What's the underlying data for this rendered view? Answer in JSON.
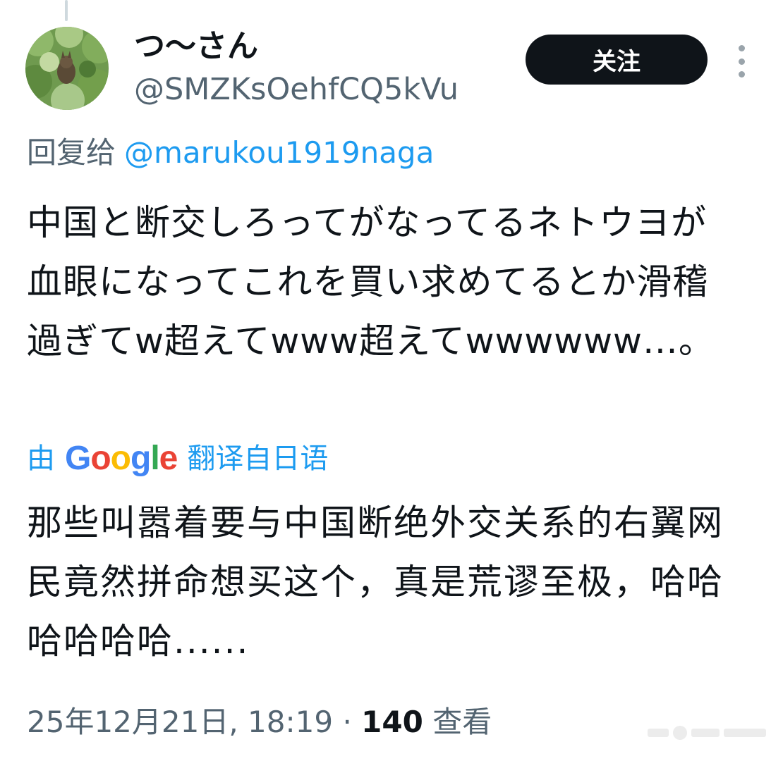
{
  "author": {
    "display_name": "つ〜さん",
    "handle": "@SMZKsOehfCQ5kVu"
  },
  "follow_label": "关注",
  "more_icon": "more-vertical-icon",
  "reply": {
    "prefix": "回复给",
    "mention": "@marukou1919naga"
  },
  "tweet_text": "中国と断交しろってがなってるネトウヨが血眼になってこれを買い求めてるとか滑稽過ぎてw超えてwww超えてwwwwww…。",
  "translation": {
    "prefix": "由",
    "provider": "Google",
    "suffix": "翻译自日语",
    "text": "那些叫嚣着要与中国断绝外交关系的右翼网民竟然拼命想买这个，真是荒谬至极，哈哈哈哈哈哈......"
  },
  "meta": {
    "timestamp": "25年12月21日, 18:19",
    "separator": "·",
    "views_count": "140",
    "views_label": "查看"
  },
  "colors": {
    "link": "#1d9bf0",
    "muted": "#536471",
    "text": "#0f1419",
    "button_bg": "#0f1419",
    "google_blue": "#4285F4",
    "google_red": "#EA4335",
    "google_yellow": "#FBBC05",
    "google_green": "#34A853"
  }
}
